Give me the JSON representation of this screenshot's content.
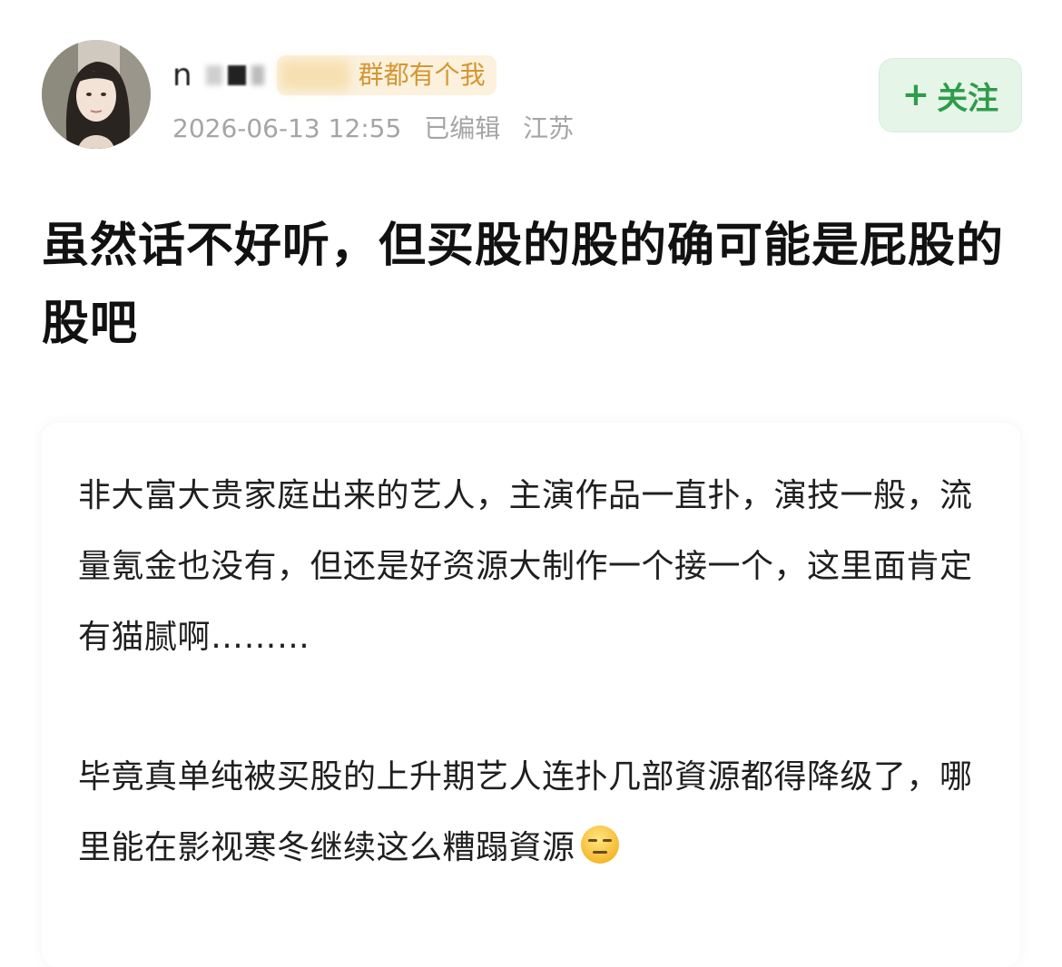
{
  "user": {
    "name_visible": "n",
    "badge_text": "群都有个我",
    "timestamp": "2026-06-13 12:55",
    "edited_label": "已编辑",
    "location": "江苏",
    "follow_label": "关注",
    "follow_icon": "plus-icon"
  },
  "post": {
    "title": "虽然话不好听，但买股的股的确可能是屁股的股吧",
    "paragraph1": "非大富大贵家庭出来的艺人，主演作品一直扑，演技一般，流量氪金也没有，但还是好资源大制作一个接一个，这里面肯定有猫腻啊………",
    "paragraph2": "毕竟真单纯被买股的上升期艺人连扑几部資源都得降级了，哪里能在影视寒冬继续这么糟蹋資源",
    "paragraph2_emoji": "expressionless-face-emoji"
  },
  "colors": {
    "follow_bg": "#e5f5e8",
    "follow_text": "#2f9c4a",
    "badge_bg": "#fbf1dc",
    "badge_text": "#d59633",
    "meta_text": "#a5a5a5"
  }
}
